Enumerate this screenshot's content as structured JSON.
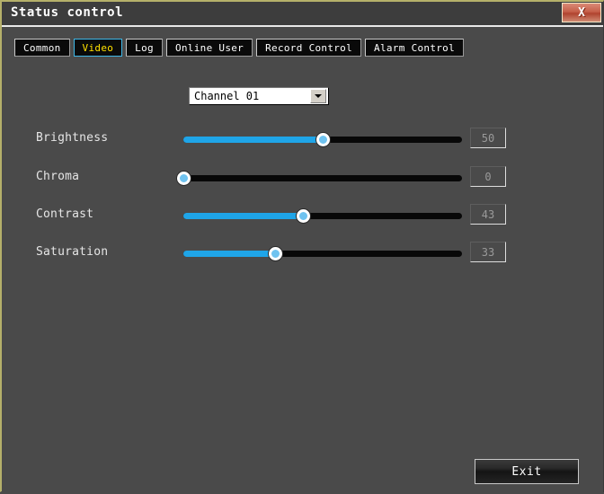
{
  "window": {
    "title": "Status control",
    "close_label": "X"
  },
  "tabs": [
    {
      "label": "Common",
      "active": false
    },
    {
      "label": "Video",
      "active": true
    },
    {
      "label": "Log",
      "active": false
    },
    {
      "label": "Online User",
      "active": false
    },
    {
      "label": "Record Control",
      "active": false
    },
    {
      "label": "Alarm Control",
      "active": false
    }
  ],
  "channel": {
    "selected": "Channel 01",
    "options": [
      "Channel 01"
    ]
  },
  "sliders": [
    {
      "label": "Brightness",
      "value": 50,
      "min": 0,
      "max": 100
    },
    {
      "label": "Chroma",
      "value": 0,
      "min": 0,
      "max": 100
    },
    {
      "label": "Contrast",
      "value": 43,
      "min": 0,
      "max": 100
    },
    {
      "label": "Saturation",
      "value": 33,
      "min": 0,
      "max": 100
    }
  ],
  "footer": {
    "exit_label": "Exit"
  },
  "colors": {
    "accent": "#1fa5e8",
    "active_tab_text": "#ffe000",
    "active_tab_border": "#3fb8e8",
    "window_bg": "#4a4a4a",
    "titlebar_bg": "#3d3d3d",
    "close_bg": "#c6604a"
  }
}
